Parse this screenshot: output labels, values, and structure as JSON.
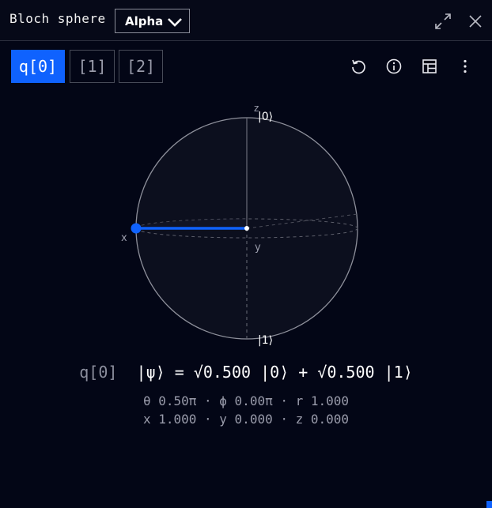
{
  "header": {
    "title": "Bloch sphere",
    "dropdown_value": "Alpha",
    "icons": [
      "expand-icon",
      "close-icon"
    ]
  },
  "tabs": [
    {
      "label": "q[0]",
      "active": true
    },
    {
      "label": "[1]",
      "active": false
    },
    {
      "label": "[2]",
      "active": false
    }
  ],
  "toolbar": {
    "icons": [
      "reset-icon",
      "info-icon",
      "table-icon",
      "overflow-menu-icon"
    ]
  },
  "sphere": {
    "axis_labels": {
      "z": "z",
      "x": "x",
      "y": "y"
    },
    "pole_labels": {
      "top": "|0⟩",
      "bottom": "|1⟩"
    },
    "state_vector": {
      "theta_pi": 0.5,
      "phi_pi": 0.0,
      "r": 1.0
    }
  },
  "state": {
    "qubit_label": "q[0]",
    "formula": "|ψ⟩ = √0.500 |0⟩ + √0.500 |1⟩",
    "angles": "θ 0.50π · ϕ 0.00π · r 1.000",
    "coords": "x 1.000 · y 0.000 · z 0.000"
  },
  "colors": {
    "accent": "#0f62fe",
    "background": "#030616",
    "sphere_outline": "#8d8f9a"
  }
}
